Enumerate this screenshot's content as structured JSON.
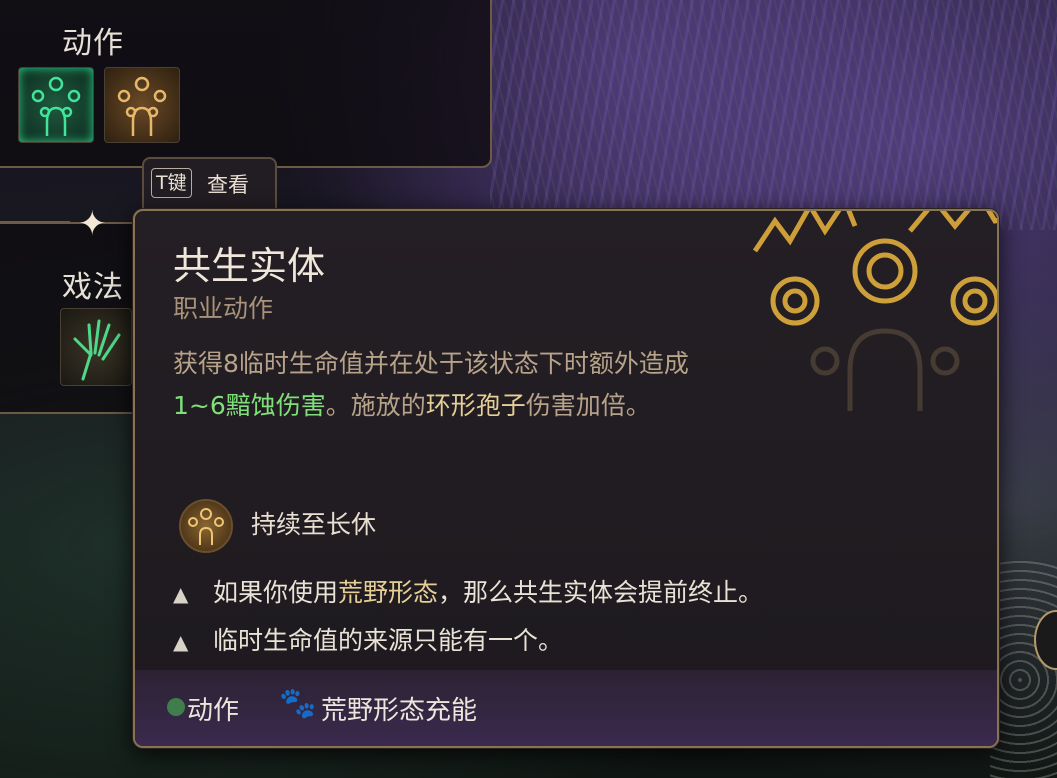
{
  "left_panel": {
    "actions_label": "动作",
    "spells_label": "戏法"
  },
  "key_hint": {
    "key": "T键",
    "label": "查看"
  },
  "tooltip": {
    "title": "共生实体",
    "subtitle": "职业动作",
    "description": {
      "part1": "获得8临时生命值并在处于该状态下时额外造成",
      "damage": "1~6黯蚀伤害",
      "part2": "。施放的",
      "highlight": "环形孢子",
      "part3": "伤害加倍。"
    },
    "duration": "持续至长休",
    "warnings": [
      {
        "prefix": "如果你使用",
        "highlight": "荒野形态",
        "suffix": "，那么共生实体会提前终止。"
      },
      {
        "text": "临时生命值的来源只能有一个。"
      }
    ],
    "footer": {
      "action_cost": "动作",
      "wild_shape": "荒野形态充能"
    }
  },
  "colors": {
    "gold_border": "#8a7254",
    "damage_green": "#7fe07a",
    "highlight_gold": "#e6cf97",
    "footer_purple": "#3a2a4e"
  },
  "icons": [
    "symbiotic-entity-icon",
    "symbiotic-entity-gold-icon",
    "chill-touch-hand-icon",
    "warning-icon",
    "paw-icon",
    "magnify-icon"
  ]
}
